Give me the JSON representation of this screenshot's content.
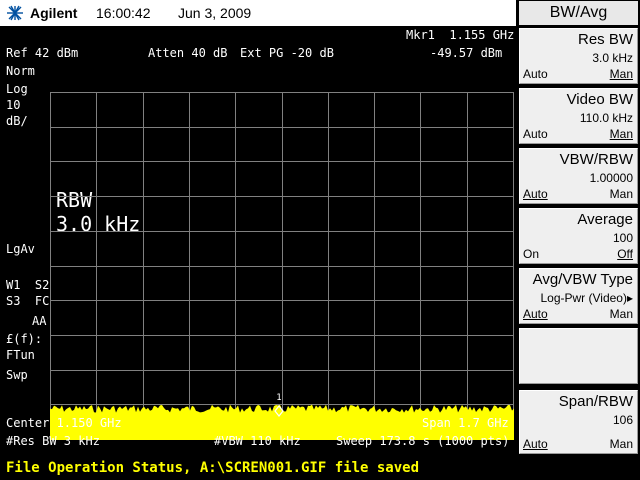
{
  "header": {
    "brand": "Agilent",
    "time": "16:00:42",
    "date": "Jun 3, 2009",
    "logo_icon": "agilent-spark-icon"
  },
  "screen": {
    "marker_label": "Mkr1  1.155 GHz",
    "marker_value": "-49.57 dBm",
    "ref_level": "Ref 42 dBm",
    "atten": "Atten 40 dB",
    "ext_pg": "Ext PG -20 dB",
    "left_labels": {
      "norm": "Norm",
      "log": "Log",
      "scale": "10",
      "unit": "dB/",
      "lgav": "LgAv",
      "w1s2": "W1  S2",
      "s3fc": "S3  FC",
      "aa": "AA",
      "ff": "£(f):",
      "ftun": "FTun",
      "swp": "Swp"
    },
    "rbw_label": "RBW",
    "rbw_value": "3.0 kHz",
    "marker_number": "1",
    "center": "Center 1.150 GHz",
    "span": "Span 1.7 GHz",
    "res_bw": "#Res BW 3 kHz",
    "vbw": "#VBW 110 kHz",
    "sweep": "Sweep 173.8 s (1000 pts)",
    "trace_color": "#ffff00",
    "grid_color": "#808080",
    "trace_noise_level_fraction": 0.09
  },
  "menu": {
    "title": "BW/Avg",
    "keys": [
      {
        "label": "Res BW",
        "value": "3.0 kHz",
        "left": "Auto",
        "right": "Man",
        "underlined": "right"
      },
      {
        "label": "Video BW",
        "value": "110.0 kHz",
        "left": "Auto",
        "right": "Man",
        "underlined": "right"
      },
      {
        "label": "VBW/RBW",
        "value": "1.00000",
        "left": "Auto",
        "right": "Man",
        "underlined": "left"
      },
      {
        "label": "Average",
        "value": "100",
        "left": "On",
        "right": "Off",
        "underlined": "right"
      },
      {
        "label": "Avg/VBW Type",
        "value": "Log-Pwr (Video)▸",
        "left": "Auto",
        "right": "Man",
        "underlined": "left"
      },
      {
        "label": "",
        "value": "",
        "left": "",
        "right": "",
        "underlined": ""
      },
      {
        "label": "Span/RBW",
        "value": "106",
        "left": "Auto",
        "right": "Man",
        "underlined": "left"
      }
    ]
  },
  "status": {
    "text": "File Operation Status, A:\\SCREN001.GIF file saved",
    "color": "#ffff00"
  }
}
